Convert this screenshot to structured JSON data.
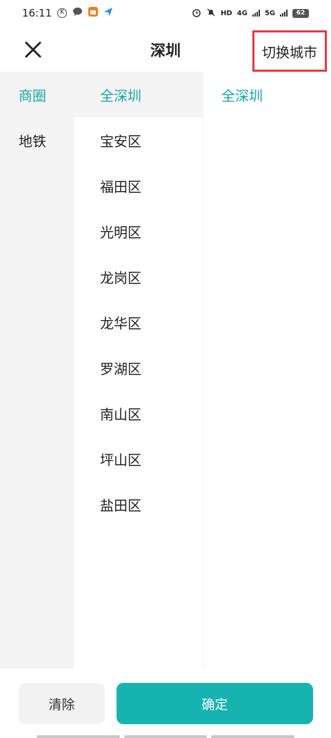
{
  "status_bar": {
    "time": "16:11",
    "battery": "62",
    "network_1": "4G",
    "network_2": "5G",
    "hd_label": "HD"
  },
  "header": {
    "title": "深圳",
    "switch_city_label": "切换城市"
  },
  "categories": [
    {
      "label": "商圈",
      "active": true
    },
    {
      "label": "地铁",
      "active": false
    }
  ],
  "districts": [
    {
      "label": "全深圳",
      "active": true
    },
    {
      "label": "宝安区",
      "active": false
    },
    {
      "label": "福田区",
      "active": false
    },
    {
      "label": "光明区",
      "active": false
    },
    {
      "label": "龙岗区",
      "active": false
    },
    {
      "label": "龙华区",
      "active": false
    },
    {
      "label": "罗湖区",
      "active": false
    },
    {
      "label": "南山区",
      "active": false
    },
    {
      "label": "坪山区",
      "active": false
    },
    {
      "label": "盐田区",
      "active": false
    }
  ],
  "sub_areas": [
    {
      "label": "全深圳",
      "active": true
    }
  ],
  "footer": {
    "clear_label": "清除",
    "confirm_label": "确定"
  },
  "colors": {
    "accent": "#17a5a8",
    "confirm_bg": "#17b3b1",
    "highlight_border": "#e8383d"
  }
}
